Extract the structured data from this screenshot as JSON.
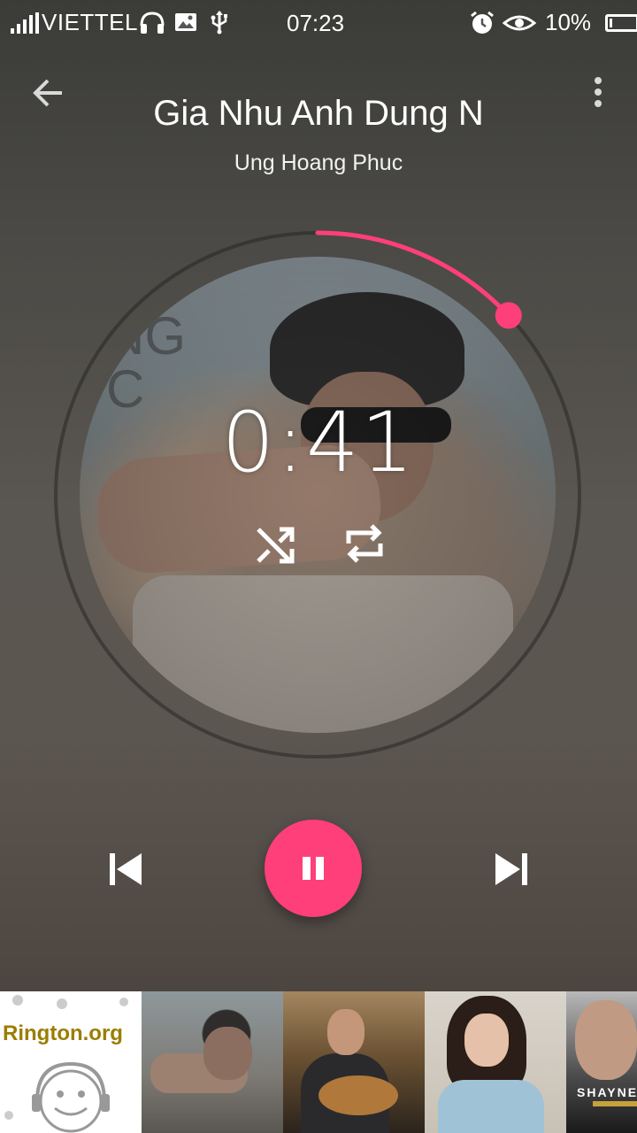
{
  "status_bar": {
    "carrier": "VIETTEL",
    "time": "07:23",
    "battery_percent": "10%",
    "battery_level": 0.1,
    "icons_left": [
      "headphones-icon",
      "image-icon",
      "usb-icon"
    ],
    "icons_right": [
      "alarm-icon",
      "eye-icon"
    ]
  },
  "header": {
    "back_icon": "arrow-back-icon",
    "menu_icon": "more-vert-icon",
    "title": "Gia Nhu Anh Dung N",
    "artist": "Ung Hoang Phuc"
  },
  "player": {
    "elapsed": "0:41",
    "progress": 0.13,
    "accent_color": "#ff3f7a",
    "shuffle_icon": "shuffle-icon",
    "repeat_icon": "repeat-icon"
  },
  "controls": {
    "prev_icon": "skip-previous-icon",
    "play_icon": "pause-icon",
    "next_icon": "skip-next-icon"
  },
  "queue": {
    "items": [
      {
        "label": "Rington.org"
      },
      {
        "label": ""
      },
      {
        "label": ""
      },
      {
        "label": ""
      },
      {
        "label": "SHAYNE"
      }
    ]
  }
}
